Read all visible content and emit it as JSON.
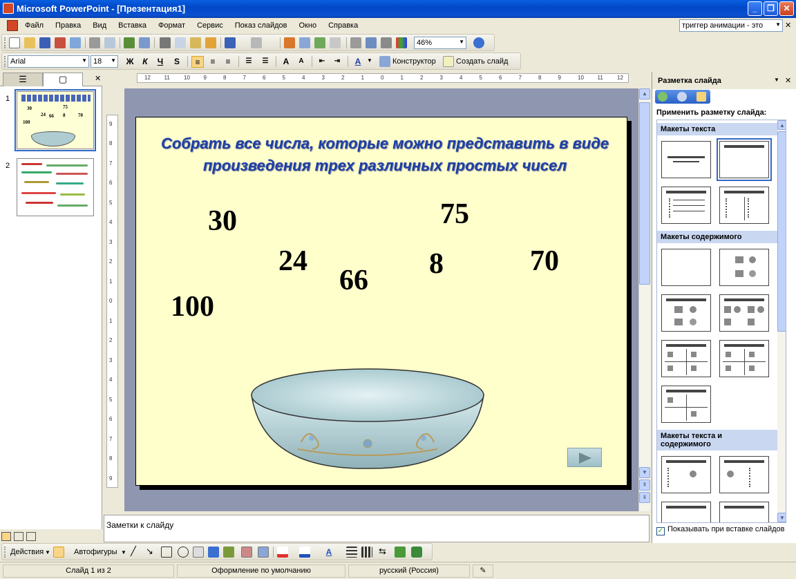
{
  "window": {
    "title": "Microsoft PowerPoint - [Презентация1]"
  },
  "menu": [
    "Файл",
    "Правка",
    "Вид",
    "Вставка",
    "Формат",
    "Сервис",
    "Показ слайдов",
    "Окно",
    "Справка"
  ],
  "help": {
    "value": "триггер анимации - это"
  },
  "standard_toolbar": {
    "zoom": "46%"
  },
  "format_toolbar": {
    "font": "Arial",
    "size": "18",
    "bold": "Ж",
    "italic": "К",
    "underline": "Ч",
    "shadow": "S",
    "designer": "Конструктор",
    "new_slide": "Создать слайд"
  },
  "slides_pane": {
    "thumb_numbers": [
      "1",
      "2"
    ]
  },
  "slide": {
    "title": "Собрать все числа, которые можно представить в виде произведения трех различных простых чисел",
    "numbers": [
      "30",
      "75",
      "24",
      "8",
      "70",
      "66",
      "100"
    ]
  },
  "notes": {
    "placeholder": "Заметки к слайду"
  },
  "drawing_toolbar": {
    "actions": "Действия",
    "autoshapes": "Автофигуры"
  },
  "status": {
    "slide_of": "Слайд 1 из 2",
    "design": "Оформление по умолчанию",
    "language": "русский (Россия)"
  },
  "taskpane": {
    "title": "Разметка слайда",
    "apply": "Применить разметку слайда:",
    "sections": [
      "Макеты текста",
      "Макеты содержимого",
      "Макеты текста и содержимого"
    ],
    "show_on_insert": "Показывать при вставке слайдов"
  },
  "colors": {
    "slide_bg": "#FFFFCC",
    "title_text": "#1C3FA8",
    "workspace": "#8F96B0"
  }
}
